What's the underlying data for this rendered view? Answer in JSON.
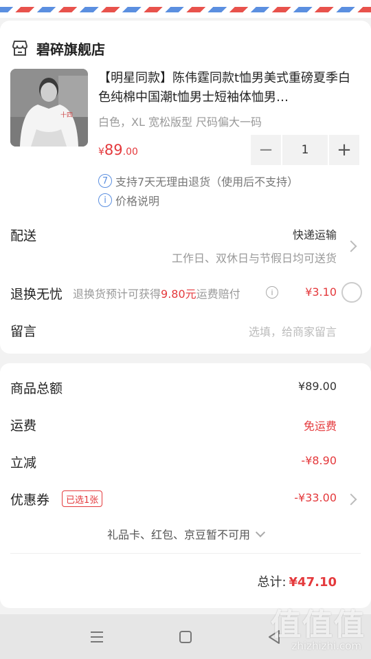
{
  "shop": {
    "name": "碧碎旗舰店",
    "icon": "store-icon"
  },
  "product": {
    "title": "【明星同款】陈伟霆同款t恤男美式重磅夏季白色纯棉中国潮t恤男士短袖体恤男…",
    "spec": "白色，XL 宽松版型 尺码偏大一码",
    "price_symbol": "¥",
    "price_int": "89",
    "price_dec": ".00",
    "shirt_print": "十四",
    "quantity": "1",
    "tips": [
      {
        "icon_text": "7",
        "text": "支持7天无理由退货（使用后不支持）"
      },
      {
        "icon_text": "i",
        "text": "价格说明"
      }
    ]
  },
  "delivery": {
    "label": "配送",
    "method": "快递运输",
    "days": "工作日、双休日与节假日均可送货"
  },
  "return_worry": {
    "label": "退换无忧",
    "desc_prefix": "退换货预计可获得",
    "desc_amount": "9.80元",
    "desc_suffix": "运费赔付",
    "price": "¥3.10"
  },
  "note": {
    "label": "留言",
    "placeholder": "选填，给商家留言"
  },
  "summary": {
    "goods_total_label": "商品总额",
    "goods_total": "¥89.00",
    "shipping_label": "运费",
    "shipping": "免运费",
    "discount_label": "立减",
    "discount": "-¥8.90",
    "coupon_label": "优惠券",
    "coupon_badge": "已选1张",
    "coupon": "-¥33.00",
    "unavailable": "礼品卡、红包、京豆暂不可用",
    "total_label": "总计:",
    "total": "¥47.10"
  },
  "watermark": {
    "big": "值值值",
    "small": "zhizhizhi.com"
  },
  "colors": {
    "accent": "#e4393c",
    "tip_blue": "#5b8fe0",
    "page_bg": "#f2f2f2"
  }
}
